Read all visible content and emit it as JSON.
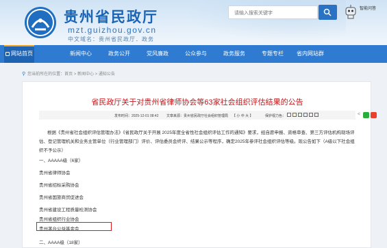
{
  "header": {
    "site_title": "贵州省民政厅",
    "site_domain": "mzt.guizhou.gov.cn",
    "site_sub": "中文域名：贵州省民政厅．政务",
    "search_placeholder": "请输入搜索关键字",
    "robot_label": "智能问答"
  },
  "nav": {
    "items": [
      "网站首页",
      "新闻中心",
      "政务公开",
      "党风廉政",
      "公众参与",
      "政务服务",
      "专题专栏",
      "省内网站群"
    ]
  },
  "breadcrumb": {
    "text": "您当前所在的位置：首页 > 新闻中心 > 通知公告"
  },
  "article": {
    "title": "省民政厅关于对贵州省律师协会等63家社会组织评估结果的公告",
    "meta": {
      "date": "发布时间：2025-12-01 08:42",
      "source": "文章来源：贵州省民政厅社会组织管理局",
      "font_size": "【 小 中 大 】",
      "color_label": "保护视力色："
    },
    "paragraph": "根据《贵州省社会组织评估管理办法》《省民政厅关于开展 2025年度全省性社会组织评估工作的通知》要求，经自愿申报、资格审查、第三方评估机构现场评估、登记管理机关和业务主管单位（行业管理部门）评价、评估委员会终评、结果公示等程序，确定2025年参评社会组织评估等级。现公告如下（A级以下社会组织不予公示）",
    "items": [
      "一、AAAAA级（6家）",
      "贵州省律师协会",
      "贵州省招标采购协会",
      "贵州省国旅商贸促进会",
      "贵州省建设工程质量检测协会",
      "贵州省组织行业协会",
      "贵州茅台公益基金会",
      "二、AAAA级（18家）"
    ]
  }
}
